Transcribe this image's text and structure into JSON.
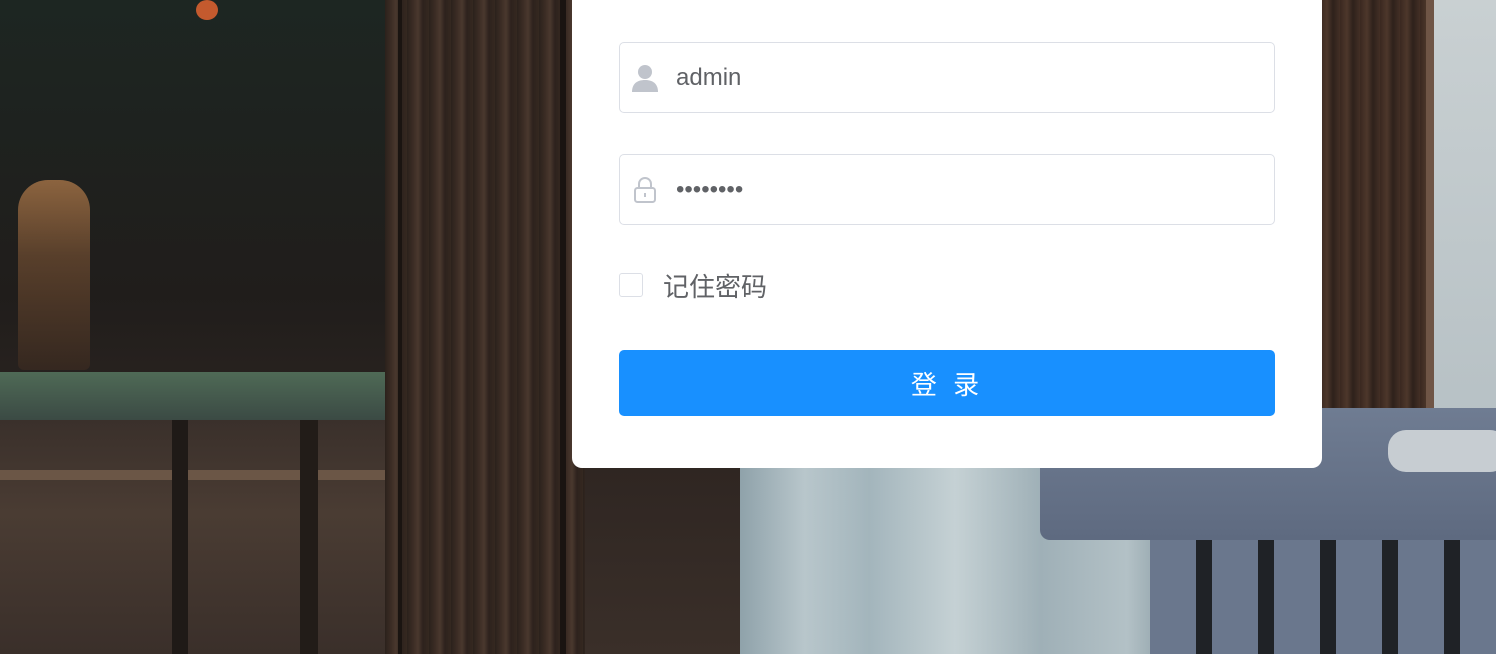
{
  "login_form": {
    "username": {
      "value": "admin",
      "icon": "user-icon"
    },
    "password": {
      "value": "••••••••",
      "icon": "lock-icon"
    },
    "remember_me": {
      "label": "记住密码",
      "checked": false
    },
    "submit": {
      "label": "登 录",
      "color": "#1890ff"
    }
  },
  "colors": {
    "card_background": "#ffffff",
    "input_border": "#dcdfe6",
    "icon_color": "#c0c4cc",
    "text_color": "#606266"
  }
}
